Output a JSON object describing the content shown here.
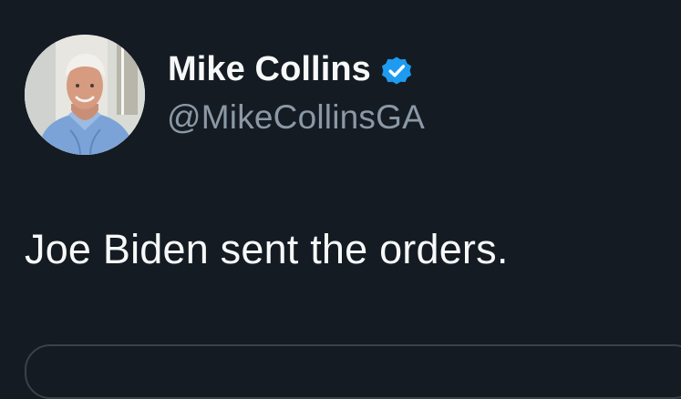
{
  "author": {
    "display_name": "Mike Collins",
    "handle": "@MikeCollinsGA",
    "verified": true,
    "avatar_icon": "profile-photo"
  },
  "tweet": {
    "text": "Joe Biden sent the orders."
  },
  "colors": {
    "background": "#151b23",
    "name": "#f7f9f9",
    "handle": "#8b98a5",
    "verified_badge": "#1d9bf0",
    "card_border": "#3b4148"
  }
}
